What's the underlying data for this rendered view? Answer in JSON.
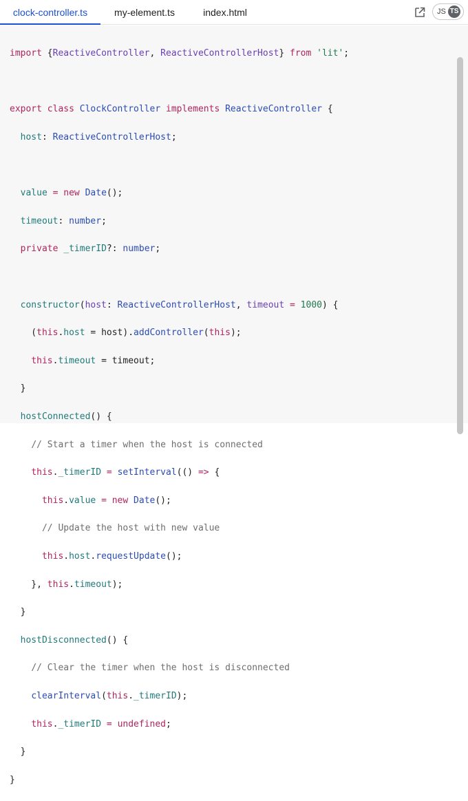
{
  "tabs": [
    {
      "label": "clock-controller.ts",
      "active": true
    },
    {
      "label": "my-element.ts",
      "active": false
    },
    {
      "label": "index.html",
      "active": false
    }
  ],
  "toolbar": {
    "open_icon": "open-in-new-window-icon",
    "lang_js": "JS",
    "lang_ts": "TS",
    "selected_lang": "TS"
  },
  "colors": {
    "accent": "#1a4fd6",
    "keyword": "#b0245c",
    "identifier": "#2b4bb5",
    "property": "#1f7a7a",
    "type": "#6a3fb5",
    "comment": "#6e6e6e"
  },
  "code": {
    "l1": {
      "a": "import",
      "b": " {",
      "c": "ReactiveController",
      "d": ", ",
      "e": "ReactiveControllerHost",
      "f": "} ",
      "g": "from",
      "h": " ",
      "i": "'lit'",
      "j": ";"
    },
    "l3": {
      "a": "export",
      "b": " ",
      "c": "class",
      "d": " ",
      "e": "ClockController",
      "f": " ",
      "g": "implements",
      "h": " ",
      "i": "ReactiveController",
      "j": " {"
    },
    "l4": {
      "a": "  ",
      "b": "host",
      "c": ": ",
      "d": "ReactiveControllerHost",
      "e": ";"
    },
    "l6": {
      "a": "  ",
      "b": "value",
      "c": " = ",
      "d": "new",
      "e": " ",
      "f": "Date",
      "g": "();"
    },
    "l7": {
      "a": "  ",
      "b": "timeout",
      "c": ": ",
      "d": "number",
      "e": ";"
    },
    "l8": {
      "a": "  ",
      "b": "private",
      "c": " ",
      "d": "_timerID",
      "e": "?: ",
      "f": "number",
      "g": ";"
    },
    "l10": {
      "a": "  ",
      "b": "constructor",
      "c": "(",
      "d": "host",
      "e": ": ",
      "f": "ReactiveControllerHost",
      "g": ", ",
      "h": "timeout",
      "i": " = ",
      "j": "1000",
      "k": ") {"
    },
    "l11": {
      "a": "    (",
      "b": "this",
      "c": ".",
      "d": "host",
      "e": " = host).",
      "f": "addController",
      "g": "(",
      "h": "this",
      "i": ");"
    },
    "l12": {
      "a": "    ",
      "b": "this",
      "c": ".",
      "d": "timeout",
      "e": " = timeout;"
    },
    "l13": {
      "a": "  }"
    },
    "l14": {
      "a": "  ",
      "b": "hostConnected",
      "c": "() {"
    },
    "l15": {
      "a": "    ",
      "b": "// Start a timer when the host is connected"
    },
    "l16": {
      "a": "    ",
      "b": "this",
      "c": ".",
      "d": "_timerID",
      "e": " = ",
      "f": "setInterval",
      "g": "(() ",
      "h": "=>",
      "i": " {"
    },
    "l17": {
      "a": "      ",
      "b": "this",
      "c": ".",
      "d": "value",
      "e": " = ",
      "f": "new",
      "g": " ",
      "h": "Date",
      "i": "();"
    },
    "l18": {
      "a": "      ",
      "b": "// Update the host with new value"
    },
    "l19": {
      "a": "      ",
      "b": "this",
      "c": ".",
      "d": "host",
      "e": ".",
      "f": "requestUpdate",
      "g": "();"
    },
    "l20": {
      "a": "    }, ",
      "b": "this",
      "c": ".",
      "d": "timeout",
      "e": ");"
    },
    "l21": {
      "a": "  }"
    },
    "l22": {
      "a": "  ",
      "b": "hostDisconnected",
      "c": "() {"
    },
    "l23": {
      "a": "    ",
      "b": "// Clear the timer when the host is disconnected"
    },
    "l24": {
      "a": "    ",
      "b": "clearInterval",
      "c": "(",
      "d": "this",
      "e": ".",
      "f": "_timerID",
      "g": ");"
    },
    "l25": {
      "a": "    ",
      "b": "this",
      "c": ".",
      "d": "_timerID",
      "e": " = ",
      "f": "undefined",
      "g": ";"
    },
    "l26": {
      "a": "  }"
    },
    "l27": {
      "a": "}"
    }
  }
}
